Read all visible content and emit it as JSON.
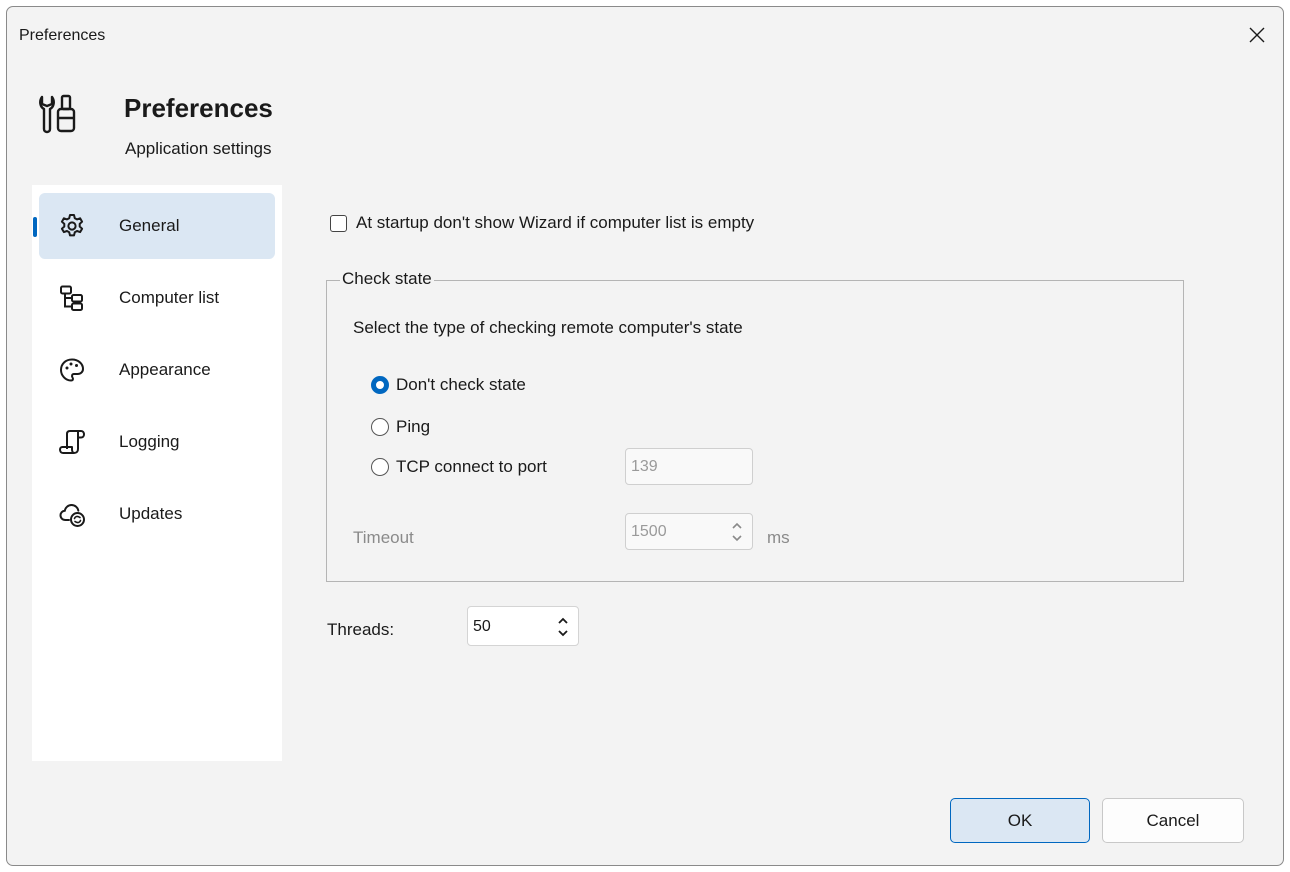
{
  "window": {
    "title": "Preferences"
  },
  "header": {
    "title": "Preferences",
    "subtitle": "Application settings",
    "icon": "wrench-screwdriver-icon"
  },
  "sidebar": {
    "active_index": 0,
    "items": [
      {
        "label": "General",
        "icon": "gear-icon"
      },
      {
        "label": "Computer list",
        "icon": "tree-icon"
      },
      {
        "label": "Appearance",
        "icon": "palette-icon"
      },
      {
        "label": "Logging",
        "icon": "scroll-icon"
      },
      {
        "label": "Updates",
        "icon": "cloud-sync-icon"
      }
    ]
  },
  "general": {
    "wizard_checkbox": {
      "label": "At startup don't show Wizard if computer list is empty",
      "checked": false
    },
    "check_state": {
      "legend": "Check state",
      "description": "Select the type  of  checking remote computer's state",
      "options": [
        {
          "label": "Don't check state",
          "checked": true
        },
        {
          "label": "Ping",
          "checked": false
        },
        {
          "label": "TCP connect to port",
          "checked": false
        }
      ],
      "port": "139",
      "timeout_label": "Timeout",
      "timeout_value": "1500",
      "timeout_unit": "ms"
    },
    "threads": {
      "label": "Threads:",
      "value": "50"
    }
  },
  "buttons": {
    "ok": "OK",
    "cancel": "Cancel"
  },
  "colors": {
    "accent": "#0067c0",
    "selected_bg": "#dbe7f3",
    "window_bg": "#f3f3f3",
    "disabled_text": "#8a8a8a"
  }
}
